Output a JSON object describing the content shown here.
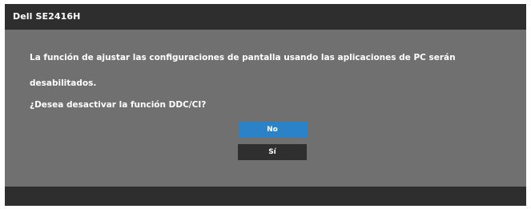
{
  "header": {
    "title": "Dell SE2416H"
  },
  "dialog": {
    "message_line1": "La función de ajustar las configuraciones de pantalla usando las aplicaciones de PC serán",
    "message_line2": "desabilitados.",
    "question": "¿Desea desactivar la función DDC/CI?",
    "no_label": "No",
    "yes_label": "Sí"
  },
  "colors": {
    "header_bg": "#2e2e2e",
    "body_bg": "#707070",
    "selected_button": "#2c82c6",
    "button_bg": "#2f2f2f",
    "text": "#ffffff"
  }
}
